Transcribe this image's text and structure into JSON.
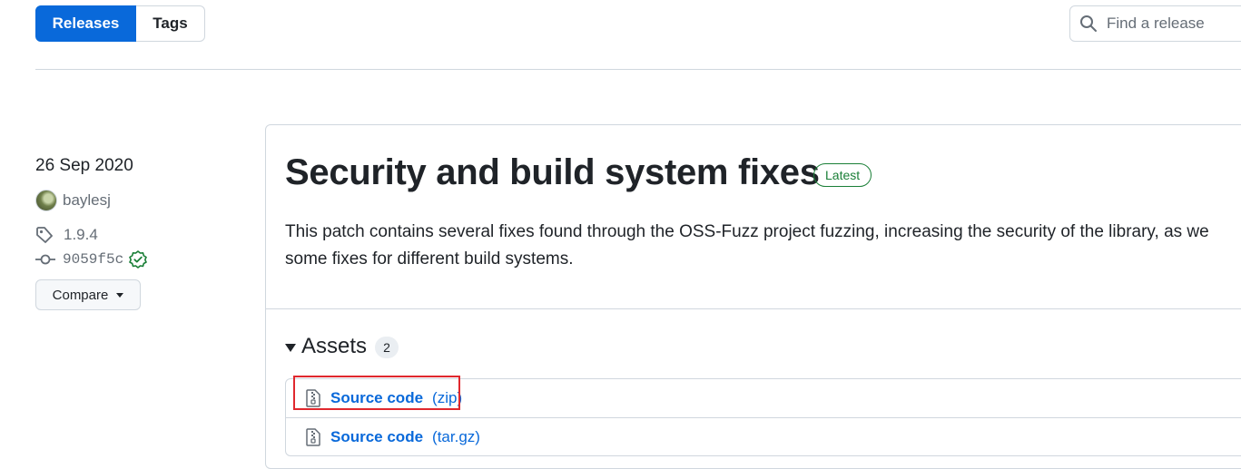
{
  "tabs": {
    "releases": "Releases",
    "tags": "Tags"
  },
  "search": {
    "placeholder": "Find a release"
  },
  "release": {
    "date": "26 Sep 2020",
    "author": "baylesj",
    "tag": "1.9.4",
    "commit": "9059f5c",
    "compare_label": "Compare",
    "title": "Security and build system fixes",
    "badge": "Latest",
    "description_line1": "This patch contains several fixes found through the OSS-Fuzz project fuzzing, increasing the security of the library, as we",
    "description_line2": "some fixes for different build systems."
  },
  "assets": {
    "heading": "Assets",
    "count": "2",
    "items": [
      {
        "name": "Source code",
        "ext": "(zip)"
      },
      {
        "name": "Source code",
        "ext": "(tar.gz)"
      }
    ]
  },
  "colors": {
    "accent": "#0969da",
    "success": "#1a7f37",
    "highlight": "#e0282e"
  },
  "icons": [
    "search-icon",
    "tag-icon",
    "commit-icon",
    "verified-icon",
    "file-zip-icon"
  ]
}
